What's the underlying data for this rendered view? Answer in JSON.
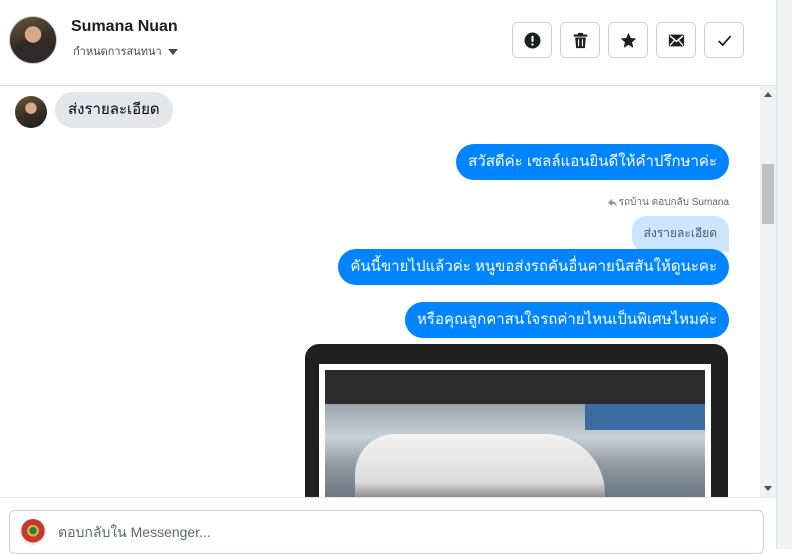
{
  "header": {
    "contact_name": "Sumana Nuan",
    "status_label": "กำหนดการสนทนา",
    "actions": [
      {
        "icon": "exclamation-icon"
      },
      {
        "icon": "trash-icon"
      },
      {
        "icon": "star-icon"
      },
      {
        "icon": "envelope-icon"
      },
      {
        "icon": "check-icon"
      }
    ]
  },
  "messages": {
    "received_1": "ส่งรายละเอียด",
    "sent_1": "สวัสดีค่ะ เซลล์แอนยินดีให้คำปรึกษาค่ะ",
    "reply_meta": "รถบ้าน ตอบกลับ Sumana",
    "reply_quote": "ส่งรายละเอียด",
    "sent_2": "คันนี้ขายไปแล้วค่ะ หนูขอส่งรถคันอื่นคายนิสสันให้ดูนะคะ",
    "sent_3": "หรือคุณลูกคาสนใจรถค่ายไหนเป็นพิเศษไหมค่ะ"
  },
  "composer": {
    "placeholder": "ตอบกลับใน Messenger..."
  },
  "colors": {
    "sent_bubble": "#0084ff",
    "received_bubble": "#e4e6eb",
    "reply_quote": "#cde4ff"
  }
}
